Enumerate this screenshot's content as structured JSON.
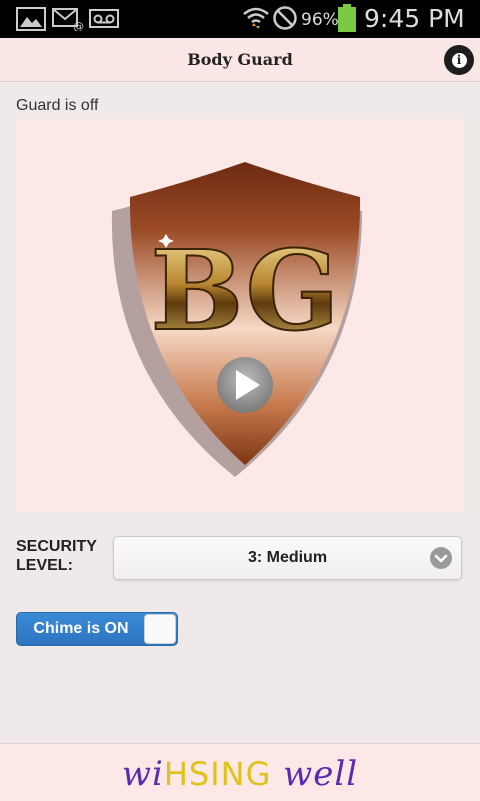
{
  "status_bar": {
    "battery_percent": "96%",
    "time": "9:45 PM",
    "icons": [
      "image-icon",
      "email-icon",
      "voicemail-icon",
      "wifi-icon",
      "no-signal-icon",
      "battery-icon"
    ],
    "battery_color": "#7ac943"
  },
  "app_bar": {
    "title": "Body Guard",
    "info_icon": "info-icon",
    "info_glyph": "i"
  },
  "guard": {
    "status": "Guard is off",
    "logo_letters": "BG",
    "play_icon": "play-icon"
  },
  "security": {
    "label": "Security Level:",
    "selected": "3: Medium"
  },
  "chime": {
    "label": "Chime is ON",
    "on": true,
    "accent": "#2d7bc8"
  },
  "footer": {
    "brand_part1": "wi",
    "brand_part2": "HSING",
    "brand_part3": " well"
  }
}
